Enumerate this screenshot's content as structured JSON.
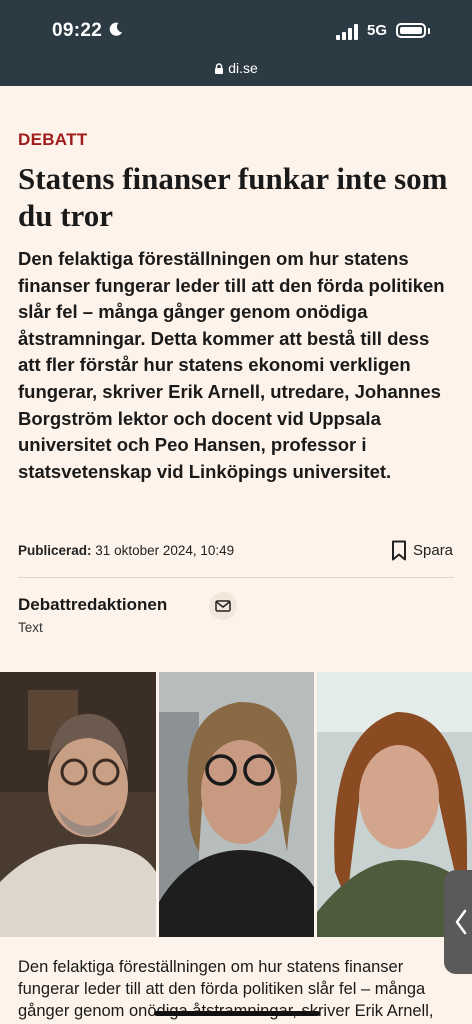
{
  "status_bar": {
    "time": "09:22",
    "network": "5G",
    "url": "di.se"
  },
  "article": {
    "kicker": "DEBATT",
    "headline": "Statens finanser funkar inte som du tror",
    "lead": "Den felaktiga föreställningen om hur statens finanser fungerar leder till att den förda politiken slår fel – många gånger genom onödiga åtstramningar. Detta kommer att bestå till dess att fler förstår hur statens ekonomi verkligen fungerar, skriver Erik Arnell, utredare, Johannes Borgström lektor och docent vid Uppsala universitet och Peo Hansen, professor i statsvetenskap vid Linköpings universitet.",
    "published_label": "Publicerad:",
    "published_date": "31 oktober 2024, 10:49",
    "save_label": "Spara",
    "author": "Debattredaktionen",
    "author_role": "Text",
    "body_start": "Den felaktiga föreställningen om hur statens finanser fungerar leder till att den förda politiken slår fel – många gånger genom onödiga åtstramningar, skriver Erik Arnell,"
  },
  "icons": {
    "moon": "moon-icon",
    "signal": "signal-bars-icon",
    "battery": "battery-icon",
    "lock": "lock-icon",
    "bookmark": "bookmark-icon",
    "mail": "mail-icon",
    "chevron": "chevron-left-icon"
  },
  "colors": {
    "status_bar_bg": "#2c3a44",
    "page_bg": "#fdf3ea",
    "kicker": "#a01d1d"
  }
}
